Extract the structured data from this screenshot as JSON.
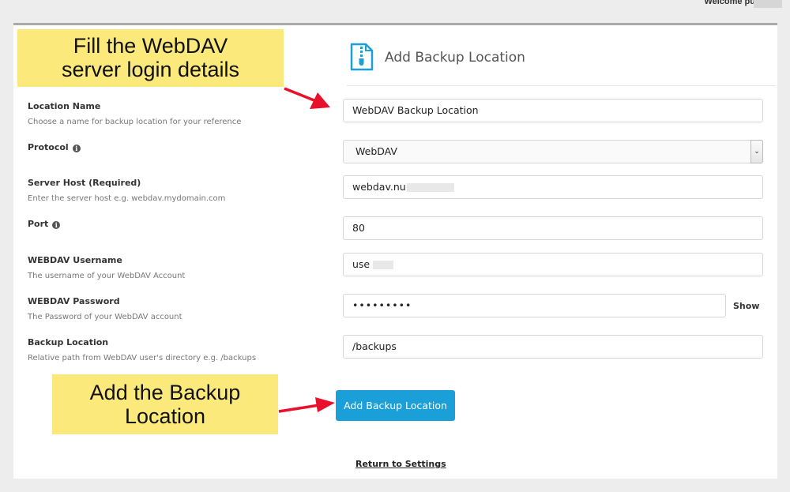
{
  "topbar": {
    "welcome_text": "Welcome pu"
  },
  "header": {
    "title": "Add Backup Location",
    "icon": "zip-file-icon"
  },
  "form": {
    "location_name": {
      "label": "Location Name",
      "help": "Choose a name for backup location for your reference",
      "value": "WebDAV Backup Location"
    },
    "protocol": {
      "label": "Protocol",
      "value": "WebDAV"
    },
    "server_host": {
      "label": "Server Host (Required)",
      "help": "Enter the server host e.g. webdav.mydomain.com",
      "value": "webdav.nu"
    },
    "port": {
      "label": "Port",
      "value": "80"
    },
    "username": {
      "label": "WEBDAV Username",
      "help": "The username of your WebDAV Account",
      "value": "use"
    },
    "password": {
      "label": "WEBDAV Password",
      "help": "The Password of your WebDAV account",
      "value": "•••••••••",
      "show_label": "Show"
    },
    "backup_location": {
      "label": "Backup Location",
      "help": "Relative path from WebDAV user's directory e.g. /backups",
      "value": "/backups"
    }
  },
  "actions": {
    "submit_label": "Add Backup Location",
    "return_label": "Return to Settings"
  },
  "callouts": {
    "top_line1": "Fill the WebDAV",
    "top_line2": "server login details",
    "bottom_line1": "Add the Backup",
    "bottom_line2": "Location"
  },
  "colors": {
    "accent": "#1a9fd8",
    "callout_bg": "#fbe97b",
    "arrow": "#e8102b"
  }
}
